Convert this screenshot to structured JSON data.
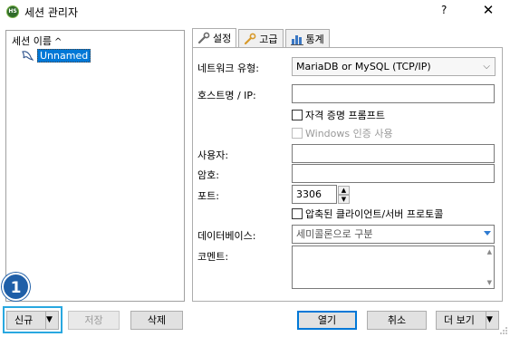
{
  "window": {
    "title": "세션 관리자",
    "help_label": "?",
    "close_label": "✕",
    "app_icon_text": "HS"
  },
  "session_list": {
    "header": "세션 이름",
    "sort_indicator": "^",
    "items": [
      {
        "label": "Unnamed",
        "selected": true
      }
    ]
  },
  "tabs": [
    {
      "label": "설정",
      "active": true,
      "icon": "wrench-icon"
    },
    {
      "label": "고급",
      "active": false,
      "icon": "wrench-gold-icon"
    },
    {
      "label": "통계",
      "active": false,
      "icon": "bar-chart-icon"
    }
  ],
  "settings": {
    "network_type_label": "네트워크 유형:",
    "network_type_value": "MariaDB or MySQL (TCP/IP)",
    "host_label": "호스트명 / IP:",
    "host_value": "",
    "prompt_credentials_label": "자격 증명 프롬프트",
    "prompt_credentials_checked": false,
    "windows_auth_label": "Windows 인증 사용",
    "windows_auth_checked": false,
    "windows_auth_enabled": false,
    "user_label": "사용자:",
    "user_value": "",
    "password_label": "암호:",
    "password_value": "",
    "port_label": "포트:",
    "port_value": "3306",
    "compressed_label": "압축된 클라이언트/서버 프로토콜",
    "compressed_checked": false,
    "databases_label": "데이터베이스:",
    "databases_placeholder": "세미콜론으로 구분",
    "comment_label": "코멘트:",
    "comment_value": ""
  },
  "buttons": {
    "new": "신규",
    "save": "저장",
    "delete": "삭제",
    "open": "열기",
    "cancel": "취소",
    "more": "더 보기"
  },
  "annotation": {
    "step_number": "1"
  },
  "colors": {
    "selection": "#0078d7",
    "highlight_box": "#29a8e0",
    "badge": "#1f5fa8"
  }
}
